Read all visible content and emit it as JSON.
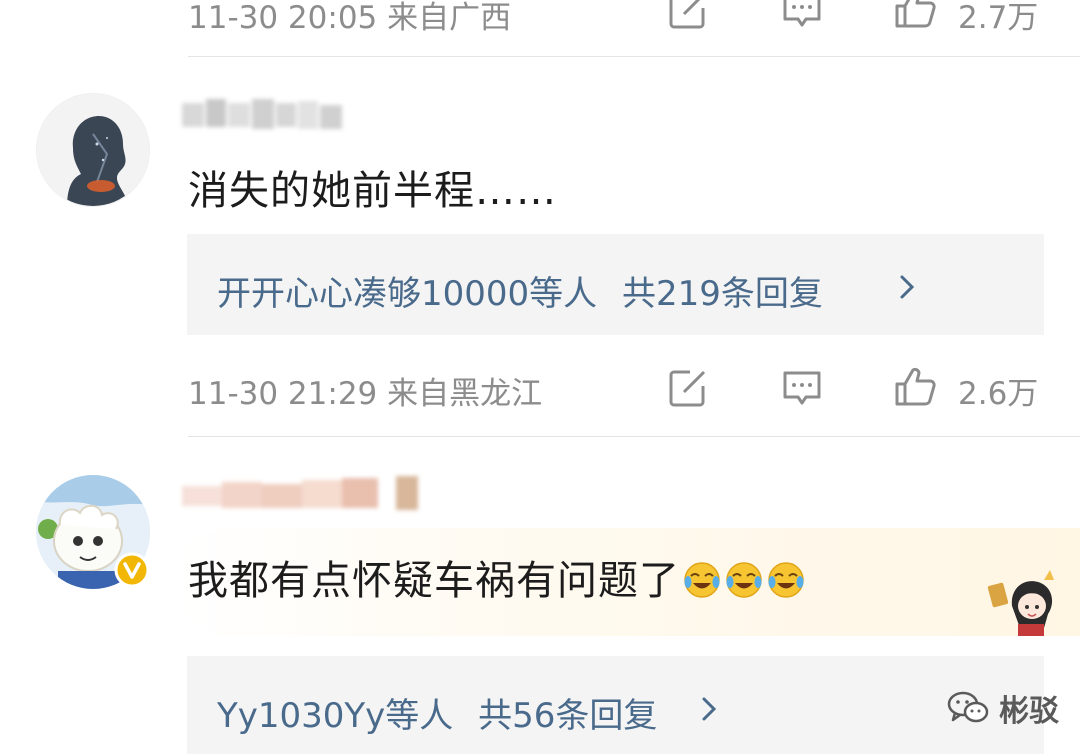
{
  "top_meta": {
    "time": "11-30 20:05",
    "location": "来自广西",
    "like_count": "2.7万"
  },
  "comments": [
    {
      "text": "消失的她前半程……",
      "reply_summary": {
        "names": "开开心心凑够10000等人",
        "count": "共219条回复"
      },
      "time": "11-30 21:29",
      "location": "来自黑龙江",
      "like_count": "2.6万"
    },
    {
      "text": "我都有点怀疑车祸有问题了",
      "emoji_count": 3,
      "reply_summary": {
        "names": "Yy1030Yy等人",
        "count": "共56条回复"
      }
    }
  ],
  "watermark": {
    "text": "彬驳"
  },
  "colors": {
    "link": "#4a6a8c",
    "meta": "#8c8c8c",
    "reply_bg": "#f4f4f4",
    "verified": "#f2b705"
  },
  "icons": [
    "repost-icon",
    "comment-icon",
    "like-icon",
    "chevron-right-icon",
    "verified-badge-icon",
    "laugh-cry-emoji",
    "wechat-icon"
  ]
}
